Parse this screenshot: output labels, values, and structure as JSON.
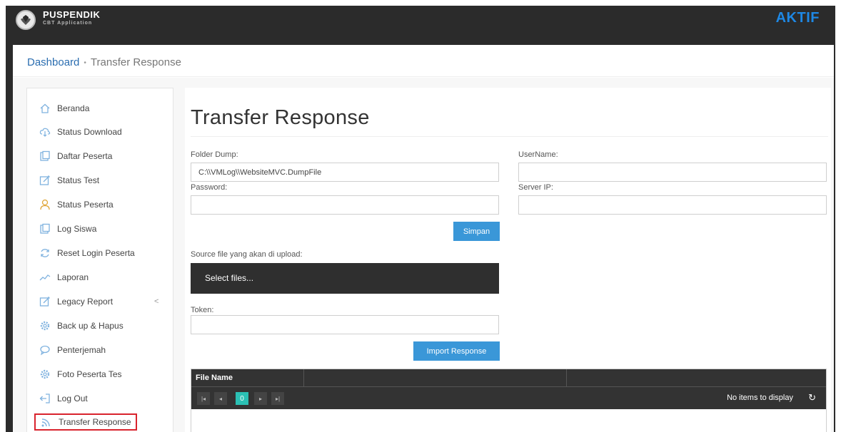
{
  "header": {
    "brand_title": "PUSPENDIK",
    "brand_subtitle": "CBT Application",
    "status": "AKTIF",
    "status_color": "#1e88e5"
  },
  "breadcrumb": {
    "home": "Dashboard",
    "separator": "•",
    "current": "Transfer Response"
  },
  "sidebar": {
    "items": [
      {
        "label": "Beranda",
        "icon": "home-icon"
      },
      {
        "label": "Status Download",
        "icon": "cloud-download-icon"
      },
      {
        "label": "Daftar Peserta",
        "icon": "folder-icon"
      },
      {
        "label": "Status Test",
        "icon": "edit-icon"
      },
      {
        "label": "Status Peserta",
        "icon": "user-icon"
      },
      {
        "label": "Log Siswa",
        "icon": "folder-icon"
      },
      {
        "label": "Reset Login Peserta",
        "icon": "refresh-icon"
      },
      {
        "label": "Laporan",
        "icon": "chart-line-icon"
      },
      {
        "label": "Legacy Report",
        "icon": "edit-icon",
        "chevron": "<"
      },
      {
        "label": "Back up & Hapus",
        "icon": "gear-icon"
      },
      {
        "label": "Penterjemah",
        "icon": "chat-icon"
      },
      {
        "label": "Foto Peserta Tes",
        "icon": "gear-icon"
      },
      {
        "label": "Log Out",
        "icon": "logout-icon"
      },
      {
        "label": "Transfer Response",
        "icon": "rss-icon"
      }
    ]
  },
  "main": {
    "title": "Transfer Response",
    "folder_dump_label": "Folder Dump:",
    "folder_dump_value": "C:\\\\VMLog\\\\WebsiteMVC.DumpFile",
    "username_label": "UserName:",
    "username_value": "",
    "password_label": "Password:",
    "password_value": "",
    "server_ip_label": "Server IP:",
    "server_ip_value": "",
    "save_label": "Simpan",
    "source_label": "Source file yang akan di upload:",
    "select_files_label": "Select files...",
    "token_label": "Token:",
    "token_value": "",
    "import_label": "Import Response"
  },
  "grid": {
    "columns": [
      "File Name",
      "",
      ""
    ],
    "current_page": "0",
    "empty_text": "No items to display"
  },
  "colors": {
    "accent": "#3a97d8",
    "dark": "#2b2b2b",
    "pager_active": "#2bc0b4",
    "active_border": "#d9232d"
  }
}
